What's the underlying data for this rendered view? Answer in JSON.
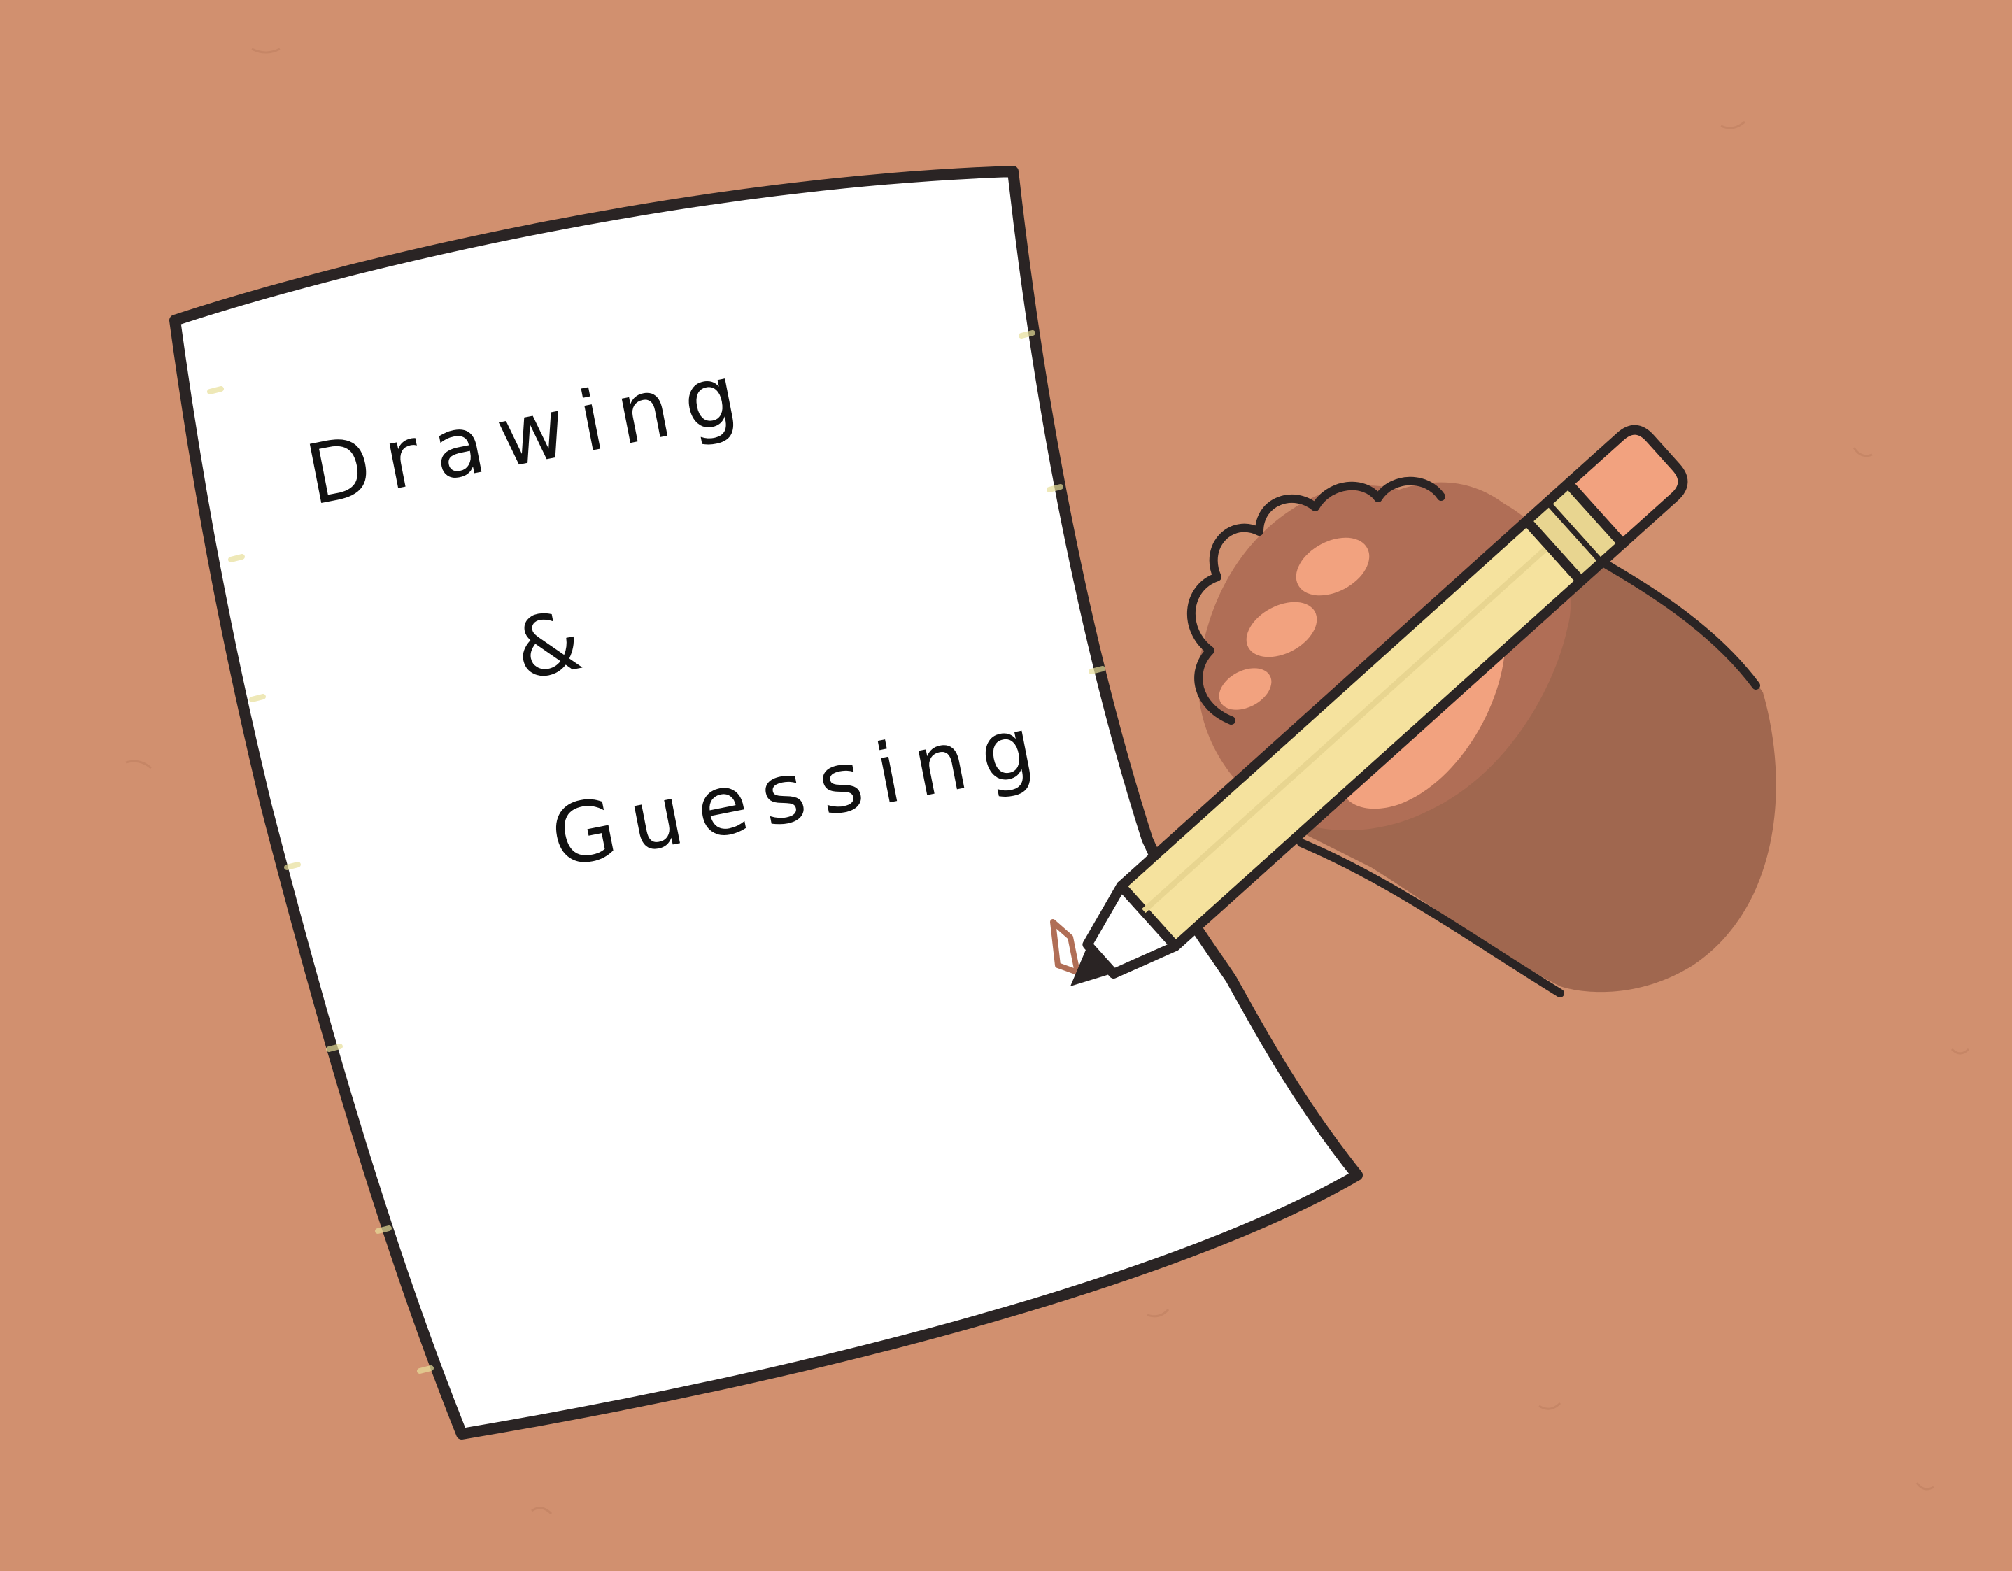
{
  "title": {
    "line1": "Drawing",
    "line2": "&",
    "line3": "Guessing"
  },
  "colors": {
    "background": "#d1906f",
    "paper": "#ffffff",
    "outline": "#2a2424",
    "pencil_body": "#f5e29e",
    "pencil_eraser": "#f2a27f",
    "pencil_ferrule": "#e8d590",
    "hand": "#b06e56",
    "fingernails": "#f2a27f",
    "sleeve": "#a0674f"
  }
}
